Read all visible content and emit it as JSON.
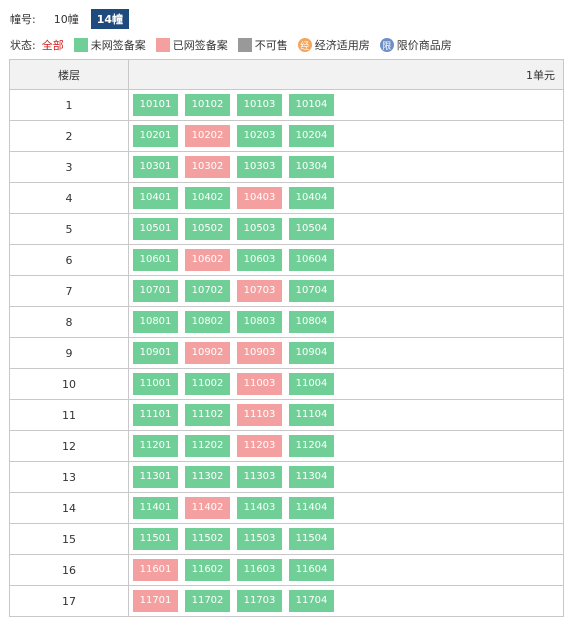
{
  "building_label": "幢号:",
  "buildings": [
    {
      "label": "10幢",
      "active": false
    },
    {
      "label": "14幢",
      "active": true
    }
  ],
  "status_label": "状态:",
  "status_all": "全部",
  "legend": [
    {
      "label": "未网签备案",
      "color": "#6fcf97",
      "icon": "green-square-icon"
    },
    {
      "label": "已网签备案",
      "color": "#f4a0a0",
      "icon": "pink-square-icon"
    },
    {
      "label": "不可售",
      "color": "#999999",
      "icon": "gray-square-icon"
    },
    {
      "label": "经济适用房",
      "color": "#f5a55a",
      "glyph": "经",
      "icon": "economic-housing-icon"
    },
    {
      "label": "限价商品房",
      "color": "#6d8fc7",
      "glyph": "限",
      "icon": "price-limited-icon"
    }
  ],
  "table": {
    "floor_header": "楼层",
    "unit_header": "1单元",
    "rows": [
      {
        "floor": "1",
        "rooms": [
          {
            "n": "10101",
            "s": "a"
          },
          {
            "n": "10102",
            "s": "a"
          },
          {
            "n": "10103",
            "s": "a"
          },
          {
            "n": "10104",
            "s": "a"
          }
        ]
      },
      {
        "floor": "2",
        "rooms": [
          {
            "n": "10201",
            "s": "a"
          },
          {
            "n": "10202",
            "s": "s"
          },
          {
            "n": "10203",
            "s": "a"
          },
          {
            "n": "10204",
            "s": "a"
          }
        ]
      },
      {
        "floor": "3",
        "rooms": [
          {
            "n": "10301",
            "s": "a"
          },
          {
            "n": "10302",
            "s": "s"
          },
          {
            "n": "10303",
            "s": "a"
          },
          {
            "n": "10304",
            "s": "a"
          }
        ]
      },
      {
        "floor": "4",
        "rooms": [
          {
            "n": "10401",
            "s": "a"
          },
          {
            "n": "10402",
            "s": "a"
          },
          {
            "n": "10403",
            "s": "s"
          },
          {
            "n": "10404",
            "s": "a"
          }
        ]
      },
      {
        "floor": "5",
        "rooms": [
          {
            "n": "10501",
            "s": "a"
          },
          {
            "n": "10502",
            "s": "a"
          },
          {
            "n": "10503",
            "s": "a"
          },
          {
            "n": "10504",
            "s": "a"
          }
        ]
      },
      {
        "floor": "6",
        "rooms": [
          {
            "n": "10601",
            "s": "a"
          },
          {
            "n": "10602",
            "s": "s"
          },
          {
            "n": "10603",
            "s": "a"
          },
          {
            "n": "10604",
            "s": "a"
          }
        ]
      },
      {
        "floor": "7",
        "rooms": [
          {
            "n": "10701",
            "s": "a"
          },
          {
            "n": "10702",
            "s": "a"
          },
          {
            "n": "10703",
            "s": "s"
          },
          {
            "n": "10704",
            "s": "a"
          }
        ]
      },
      {
        "floor": "8",
        "rooms": [
          {
            "n": "10801",
            "s": "a"
          },
          {
            "n": "10802",
            "s": "a"
          },
          {
            "n": "10803",
            "s": "a"
          },
          {
            "n": "10804",
            "s": "a"
          }
        ]
      },
      {
        "floor": "9",
        "rooms": [
          {
            "n": "10901",
            "s": "a"
          },
          {
            "n": "10902",
            "s": "s"
          },
          {
            "n": "10903",
            "s": "s"
          },
          {
            "n": "10904",
            "s": "a"
          }
        ]
      },
      {
        "floor": "10",
        "rooms": [
          {
            "n": "11001",
            "s": "a"
          },
          {
            "n": "11002",
            "s": "a"
          },
          {
            "n": "11003",
            "s": "s"
          },
          {
            "n": "11004",
            "s": "a"
          }
        ]
      },
      {
        "floor": "11",
        "rooms": [
          {
            "n": "11101",
            "s": "a"
          },
          {
            "n": "11102",
            "s": "a"
          },
          {
            "n": "11103",
            "s": "s"
          },
          {
            "n": "11104",
            "s": "a"
          }
        ]
      },
      {
        "floor": "12",
        "rooms": [
          {
            "n": "11201",
            "s": "a"
          },
          {
            "n": "11202",
            "s": "a"
          },
          {
            "n": "11203",
            "s": "s"
          },
          {
            "n": "11204",
            "s": "a"
          }
        ]
      },
      {
        "floor": "13",
        "rooms": [
          {
            "n": "11301",
            "s": "a"
          },
          {
            "n": "11302",
            "s": "a"
          },
          {
            "n": "11303",
            "s": "a"
          },
          {
            "n": "11304",
            "s": "a"
          }
        ]
      },
      {
        "floor": "14",
        "rooms": [
          {
            "n": "11401",
            "s": "a"
          },
          {
            "n": "11402",
            "s": "s"
          },
          {
            "n": "11403",
            "s": "a"
          },
          {
            "n": "11404",
            "s": "a"
          }
        ]
      },
      {
        "floor": "15",
        "rooms": [
          {
            "n": "11501",
            "s": "a"
          },
          {
            "n": "11502",
            "s": "a"
          },
          {
            "n": "11503",
            "s": "a"
          },
          {
            "n": "11504",
            "s": "a"
          }
        ]
      },
      {
        "floor": "16",
        "rooms": [
          {
            "n": "11601",
            "s": "s"
          },
          {
            "n": "11602",
            "s": "a"
          },
          {
            "n": "11603",
            "s": "a"
          },
          {
            "n": "11604",
            "s": "a"
          }
        ]
      },
      {
        "floor": "17",
        "rooms": [
          {
            "n": "11701",
            "s": "s"
          },
          {
            "n": "11702",
            "s": "a"
          },
          {
            "n": "11703",
            "s": "a"
          },
          {
            "n": "11704",
            "s": "a"
          }
        ]
      }
    ]
  }
}
